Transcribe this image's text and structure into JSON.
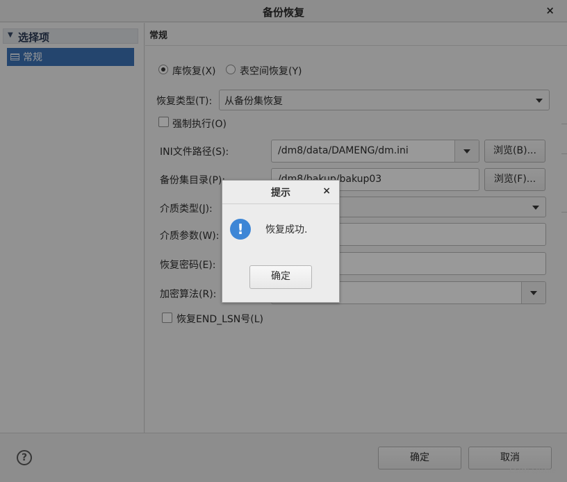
{
  "window": {
    "title": "备份恢复",
    "close_glyph": "×"
  },
  "sidebar": {
    "section_label": "选择项",
    "items": [
      {
        "label": "常规",
        "icon": "list-icon",
        "selected": true
      }
    ]
  },
  "panel": {
    "header": "常规"
  },
  "form": {
    "radio_db": "库恢复(X)",
    "radio_ts": "表空间恢复(Y)",
    "restore_type_label": "恢复类型(T):",
    "restore_type_value": "从备份集恢复",
    "force_label": "强制执行(O)",
    "ini_label": "INI文件路径(S):",
    "ini_value": "/dm8/data/DAMENG/dm.ini",
    "browse_b": "浏览(B)...",
    "backup_dir_label": "备份集目录(P):",
    "backup_dir_value": "/dm8/bakup/bakup03",
    "browse_f": "浏览(F)...",
    "media_type_label": "介质类型(J):",
    "media_param_label": "介质参数(W):",
    "password_label": "恢复密码(E):",
    "encrypt_label": "加密算法(R):",
    "end_lsn_label": "恢复END_LSN号(L)"
  },
  "footer": {
    "ok": "确定",
    "cancel": "取消",
    "help_glyph": "?",
    "watermark": "CSDN @lothe"
  },
  "dialog": {
    "title": "提示",
    "close_glyph": "×",
    "info_glyph": "!",
    "message": "恢复成功.",
    "ok": "确定"
  },
  "colors": {
    "accent": "#3d74b8",
    "info": "#3d86d6"
  }
}
